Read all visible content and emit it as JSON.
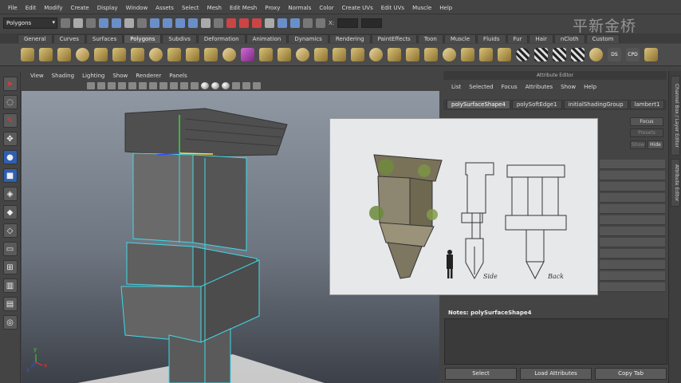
{
  "menubar": {
    "items": [
      "File",
      "Edit",
      "Modify",
      "Create",
      "Display",
      "Window",
      "Assets",
      "Select",
      "Mesh",
      "Edit Mesh",
      "Proxy",
      "Normals",
      "Color",
      "Create UVs",
      "Edit UVs",
      "Muscle",
      "Help"
    ]
  },
  "status": {
    "mode": "Polygons",
    "x_label": "X:"
  },
  "watermark": "平新金桥",
  "shelf": {
    "tabs": [
      "General",
      "Curves",
      "Surfaces",
      "Polygons",
      "Subdivs",
      "Deformation",
      "Animation",
      "Dynamics",
      "Rendering",
      "PaintEffects",
      "Toon",
      "Muscle",
      "Fluids",
      "Fur",
      "Hair",
      "nCloth",
      "Custom"
    ],
    "active_tab": "Polygons",
    "icon_labels": [
      "DS",
      "CPD"
    ]
  },
  "viewport": {
    "menu": [
      "View",
      "Shading",
      "Lighting",
      "Show",
      "Renderer",
      "Panels"
    ],
    "axis": {
      "x": "x",
      "y": "y",
      "z": "z"
    }
  },
  "reference": {
    "label_side": "Side",
    "label_back": "Back"
  },
  "attribute_editor": {
    "title": "Attribute Editor",
    "menu": [
      "List",
      "Selected",
      "Focus",
      "Attributes",
      "Show",
      "Help"
    ],
    "tabs": [
      "polySurfaceShape4",
      "polySoftEdge1",
      "initialShadingGroup",
      "lambert1"
    ],
    "active_tab": "polySurfaceShape4",
    "focus_button": "Focus",
    "presets_button": "Presets",
    "show_button": "Show",
    "hide_button": "Hide",
    "notes_label": "Notes: polySurfaceShape4",
    "buttons": [
      "Select",
      "Load Attributes",
      "Copy Tab"
    ]
  },
  "side_tabs": [
    "Channel Box / Layer Editor",
    "Attribute Editor"
  ],
  "colors": {
    "selection_edge": "#3fd9e6",
    "manip_green": "#3ed43e",
    "manip_blue": "#2f4fff",
    "manip_yellow": "#ffe43a"
  }
}
